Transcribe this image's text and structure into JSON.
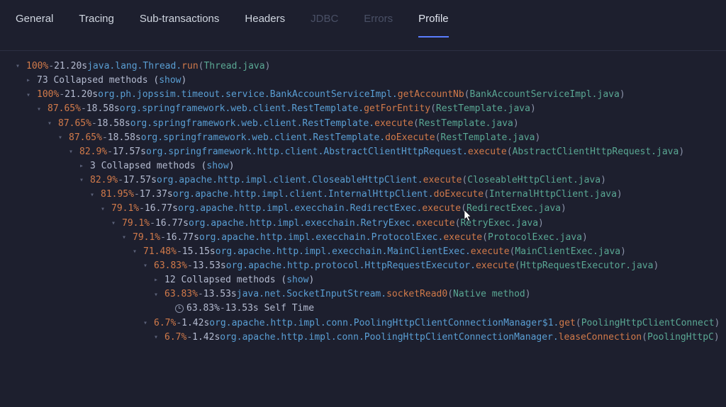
{
  "tabs": {
    "general": "General",
    "tracing": "Tracing",
    "subtransactions": "Sub-transactions",
    "headers": "Headers",
    "jdbc": "JDBC",
    "errors": "Errors",
    "profile": "Profile"
  },
  "tree_meta": {
    "dash": " - ",
    "show_label": "show",
    "self_time": "Self Time",
    "native_method": "Native method"
  },
  "rows": [
    {
      "indent": 0,
      "pct": "100%",
      "dur": "21.20s",
      "pkg": "java.lang.Thread.",
      "method": "run",
      "src": "Thread.java"
    },
    {
      "indent": 1,
      "collapsed": "73 Collapsed methods"
    },
    {
      "indent": 1,
      "pct": "100%",
      "dur": "21.20s",
      "pkg": "org.ph.jopssim.timeout.service.BankAccountServiceImpl.",
      "method": "getAccountNb",
      "src": "BankAccountServiceImpl.java"
    },
    {
      "indent": 2,
      "pct": "87.65%",
      "dur": "18.58s",
      "pkg": "org.springframework.web.client.RestTemplate.",
      "method": "getForEntity",
      "src": "RestTemplate.java"
    },
    {
      "indent": 3,
      "pct": "87.65%",
      "dur": "18.58s",
      "pkg": "org.springframework.web.client.RestTemplate.",
      "method": "execute",
      "src": "RestTemplate.java"
    },
    {
      "indent": 4,
      "pct": "87.65%",
      "dur": "18.58s",
      "pkg": "org.springframework.web.client.RestTemplate.",
      "method": "doExecute",
      "src": "RestTemplate.java"
    },
    {
      "indent": 5,
      "pct": "82.9%",
      "dur": "17.57s",
      "pkg": "org.springframework.http.client.AbstractClientHttpRequest.",
      "method": "execute",
      "src": "AbstractClientHttpRequest.java"
    },
    {
      "indent": 6,
      "collapsed": "3 Collapsed methods"
    },
    {
      "indent": 6,
      "pct": "82.9%",
      "dur": "17.57s",
      "pkg": "org.apache.http.impl.client.CloseableHttpClient.",
      "method": "execute",
      "src": "CloseableHttpClient.java"
    },
    {
      "indent": 7,
      "pct": "81.95%",
      "dur": "17.37s",
      "pkg": "org.apache.http.impl.client.InternalHttpClient.",
      "method": "doExecute",
      "src": "InternalHttpClient.java"
    },
    {
      "indent": 8,
      "pct": "79.1%",
      "dur": "16.77s",
      "pkg": "org.apache.http.impl.execchain.RedirectExec.",
      "method": "execute",
      "src": "RedirectExec.java"
    },
    {
      "indent": 9,
      "pct": "79.1%",
      "dur": "16.77s",
      "pkg": "org.apache.http.impl.execchain.RetryExec.",
      "method": "execute",
      "src": "RetryExec.java"
    },
    {
      "indent": 10,
      "pct": "79.1%",
      "dur": "16.77s",
      "pkg": "org.apache.http.impl.execchain.ProtocolExec.",
      "method": "execute",
      "src": "ProtocolExec.java"
    },
    {
      "indent": 11,
      "pct": "71.48%",
      "dur": "15.15s",
      "pkg": "org.apache.http.impl.execchain.MainClientExec.",
      "method": "execute",
      "src": "MainClientExec.java"
    },
    {
      "indent": 12,
      "pct": "63.83%",
      "dur": "13.53s",
      "pkg": "org.apache.http.protocol.HttpRequestExecutor.",
      "method": "execute",
      "src": "HttpRequestExecutor.java"
    },
    {
      "indent": 13,
      "collapsed": "12 Collapsed methods"
    },
    {
      "indent": 13,
      "pct": "63.83%",
      "dur": "13.53s",
      "pkg": "java.net.SocketInputStream.",
      "method": "socketRead0",
      "native": true
    },
    {
      "indent": 14,
      "self": true,
      "pct": "63.83%",
      "dur": "13.53s"
    },
    {
      "indent": 12,
      "pct": "6.7%",
      "dur": "1.42s",
      "pkg": "org.apache.http.impl.conn.PoolingHttpClientConnectionManager$1.",
      "method": "get",
      "src": "PoolingHttpClientConnect"
    },
    {
      "indent": 13,
      "pct": "6.7%",
      "dur": "1.42s",
      "pkg": "org.apache.http.impl.conn.PoolingHttpClientConnectionManager.",
      "method": "leaseConnection",
      "src": "PoolingHttpC"
    }
  ]
}
